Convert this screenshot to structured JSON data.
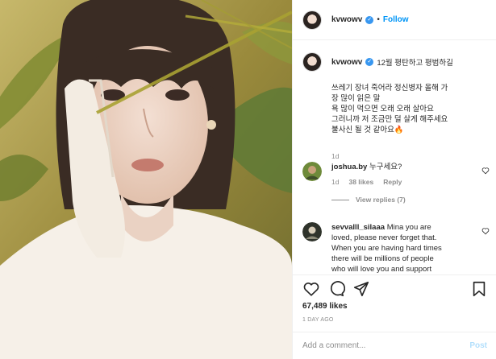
{
  "header": {
    "username": "kvwowv",
    "verified_glyph": "✓",
    "separator": "•",
    "follow_label": "Follow"
  },
  "caption": {
    "username": "kvwowv",
    "inline_text": "12월 평탄하고 평범하길",
    "lines": [
      "쓰레기 장녀 죽어라 정신병자 올해 가",
      "장 많이 읽은 말",
      "욕 많이 먹으면 오래 오래 살아요",
      "그러니까 저 조금만 덜 살게 해주세요",
      "불사신 될 것 같아요"
    ],
    "emoji": "🔥",
    "time": "1d"
  },
  "comments": [
    {
      "username": "joshua.by",
      "text": "누구세요?",
      "time": "1d",
      "likes": "38 likes",
      "reply_label": "Reply",
      "view_replies": "View replies (7)"
    },
    {
      "username": "sevvalll_silaaa",
      "lines": [
        "Mina you are",
        "loved, please never forget that.",
        "When you are having hard times",
        "there will be millions of people",
        "who will love you and support"
      ]
    }
  ],
  "actions": {
    "icons": [
      "heart-icon",
      "comment-icon",
      "share-icon",
      "bookmark-icon"
    ],
    "likes": "67,489 likes",
    "date": "1 DAY AGO"
  },
  "composer": {
    "placeholder": "Add a comment...",
    "post_label": "Post"
  },
  "colors": {
    "accent": "#0095f6",
    "post_disabled": "#b2dffc",
    "muted": "#8e8e8e"
  }
}
